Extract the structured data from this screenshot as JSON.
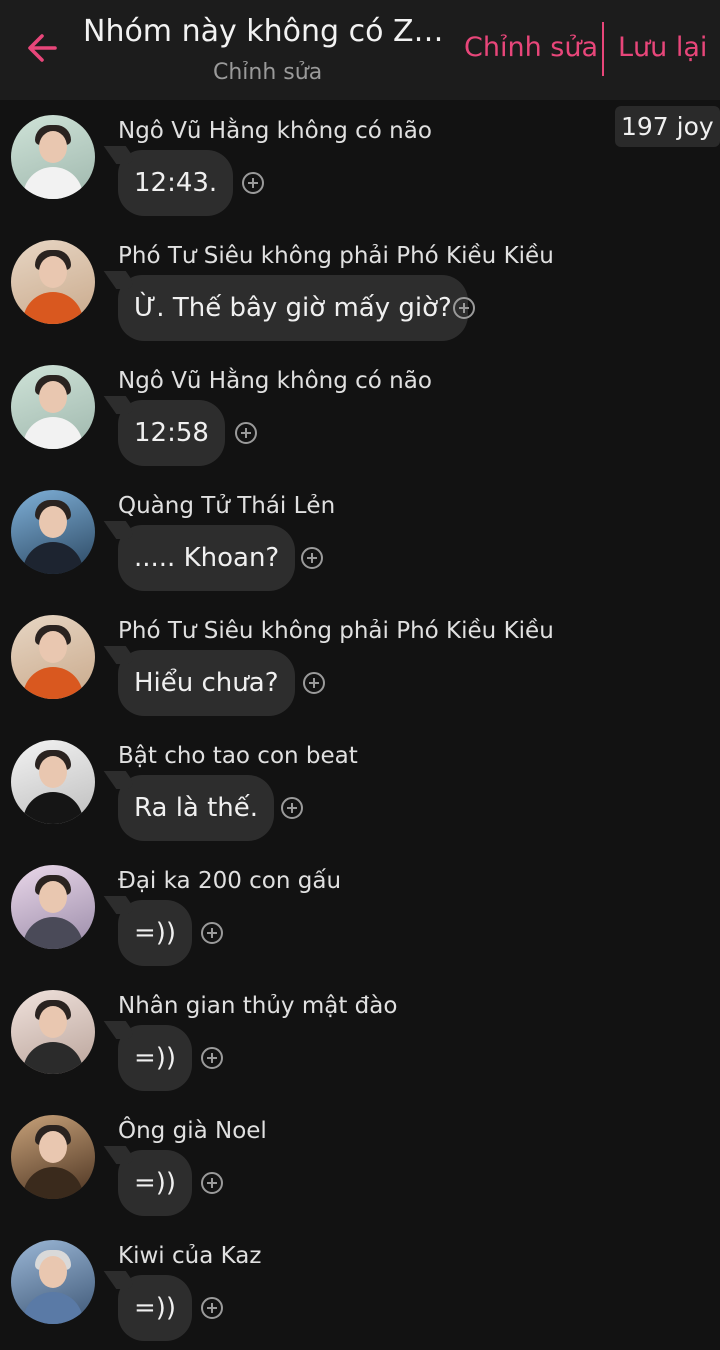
{
  "header": {
    "title": "Nhóm này không có ZKY...",
    "subtitle": "Chỉnh sửa",
    "edit_label": "Chỉnh sửa",
    "save_label": "Lưu lại",
    "accent_color": "#e8467a",
    "back_icon": "arrow-left-icon"
  },
  "joy_badge": "197 joy",
  "messages": [
    {
      "name": "Ngô Vũ Hằng không có não",
      "text": "12:43."
    },
    {
      "name": "Phó Tư Siêu không phải Phó Kiều Kiều",
      "text": "Ừ. Thế bây giờ mấy giờ?"
    },
    {
      "name": "Ngô Vũ Hằng không có não",
      "text": "12:58"
    },
    {
      "name": "Quàng Tử Thái Lẻn",
      "text": "..... Khoan?"
    },
    {
      "name": "Phó Tư Siêu không phải Phó Kiều Kiều",
      "text": "Hiểu chưa?"
    },
    {
      "name": "Bật cho tao con beat",
      "text": "Ra là thế."
    },
    {
      "name": "Đại ka 200 con gấu",
      "text": "=))"
    },
    {
      "name": "Nhân gian thủy mật đào",
      "text": "=))"
    },
    {
      "name": "Ông già Noel",
      "text": "=))"
    },
    {
      "name": "Kiwi của Kaz",
      "text": "=))"
    }
  ],
  "colors": {
    "background": "#121212",
    "header_bg": "#1c1c1c",
    "bubble_bg": "#2d2d2d"
  }
}
